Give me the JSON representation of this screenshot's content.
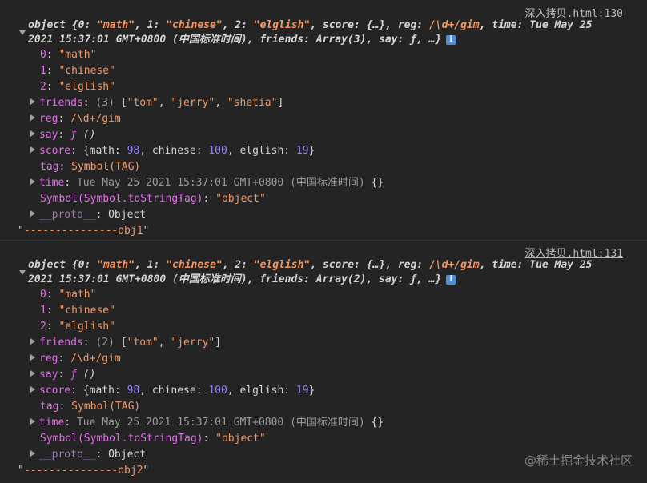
{
  "entries": [
    {
      "source_link": "深入拷贝.html:130",
      "summary": {
        "l1_prefix": "object {0: ",
        "v0": "\"math\"",
        "s1": ", 1: ",
        "v1": "\"chinese\"",
        "s2": ", 2: ",
        "v2": "\"elglish\"",
        "s3": ", score: {…}, reg: ",
        "v3": "/\\d+/gim",
        "s4": ", time: Tue May 25",
        "l2": "2021 15:37:01 GMT+0800 (中国标准时间), friends: Array(3), say: ƒ, …}",
        "info_glyph": "i"
      },
      "props": {
        "p0": {
          "key": "0",
          "sep": ": ",
          "val": "\"math\""
        },
        "p1": {
          "key": "1",
          "sep": ": ",
          "val": "\"chinese\""
        },
        "p2": {
          "key": "2",
          "sep": ": ",
          "val": "\"elglish\""
        },
        "friends": {
          "key": "friends",
          "sep": ": ",
          "count": "(3) ",
          "open": "[",
          "a": "\"tom\"",
          "c1": ", ",
          "b": "\"jerry\"",
          "c2": ", ",
          "c": "\"shetia\"",
          "close": "]"
        },
        "reg": {
          "key": "reg",
          "sep": ": ",
          "val": "/\\d+/gim"
        },
        "say": {
          "key": "say",
          "sep": ": ",
          "f": "ƒ",
          "val": " ()"
        },
        "score": {
          "key": "score",
          "sep": ": ",
          "open": "{math: ",
          "math": "98",
          "m2": ", chinese: ",
          "chinese": "100",
          "m3": ", elglish: ",
          "elglish": "19",
          "close": "}"
        },
        "tag": {
          "key": "tag",
          "sep": ": ",
          "val": "Symbol(TAG)"
        },
        "time": {
          "key": "time",
          "sep": ": ",
          "val": "Tue May 25 2021 15:37:01 GMT+0800 (中国标准时间)",
          "tail": " {}"
        },
        "symbol": {
          "key": "Symbol(Symbol.toStringTag)",
          "sep": ": ",
          "val": "\"object\""
        },
        "proto": {
          "key": "__proto__",
          "sep": ": ",
          "val": "Object"
        }
      },
      "log_string": "---------------obj1"
    },
    {
      "source_link": "深入拷贝.html:131",
      "summary": {
        "l1_prefix": "object {0: ",
        "v0": "\"math\"",
        "s1": ", 1: ",
        "v1": "\"chinese\"",
        "s2": ", 2: ",
        "v2": "\"elglish\"",
        "s3": ", score: {…}, reg: ",
        "v3": "/\\d+/gim",
        "s4": ", time: Tue May 25",
        "l2": "2021 15:37:01 GMT+0800 (中国标准时间), friends: Array(2), say: ƒ, …}",
        "info_glyph": "i"
      },
      "props": {
        "p0": {
          "key": "0",
          "sep": ": ",
          "val": "\"math\""
        },
        "p1": {
          "key": "1",
          "sep": ": ",
          "val": "\"chinese\""
        },
        "p2": {
          "key": "2",
          "sep": ": ",
          "val": "\"elglish\""
        },
        "friends": {
          "key": "friends",
          "sep": ": ",
          "count": "(2) ",
          "open": "[",
          "a": "\"tom\"",
          "c1": ", ",
          "b": "\"jerry\"",
          "close": "]"
        },
        "reg": {
          "key": "reg",
          "sep": ": ",
          "val": "/\\d+/gim"
        },
        "say": {
          "key": "say",
          "sep": ": ",
          "f": "ƒ",
          "val": " ()"
        },
        "score": {
          "key": "score",
          "sep": ": ",
          "open": "{math: ",
          "math": "98",
          "m2": ", chinese: ",
          "chinese": "100",
          "m3": ", elglish: ",
          "elglish": "19",
          "close": "}"
        },
        "tag": {
          "key": "tag",
          "sep": ": ",
          "val": "Symbol(TAG)"
        },
        "time": {
          "key": "time",
          "sep": ": ",
          "val": "Tue May 25 2021 15:37:01 GMT+0800 (中国标准时间)",
          "tail": " {}"
        },
        "symbol": {
          "key": "Symbol(Symbol.toStringTag)",
          "sep": ": ",
          "val": "\"object\""
        },
        "proto": {
          "key": "__proto__",
          "sep": ": ",
          "val": "Object"
        }
      },
      "log_string": "---------------obj2"
    }
  ],
  "quote": "\"",
  "watermark": "@稀土掘金技术社区"
}
